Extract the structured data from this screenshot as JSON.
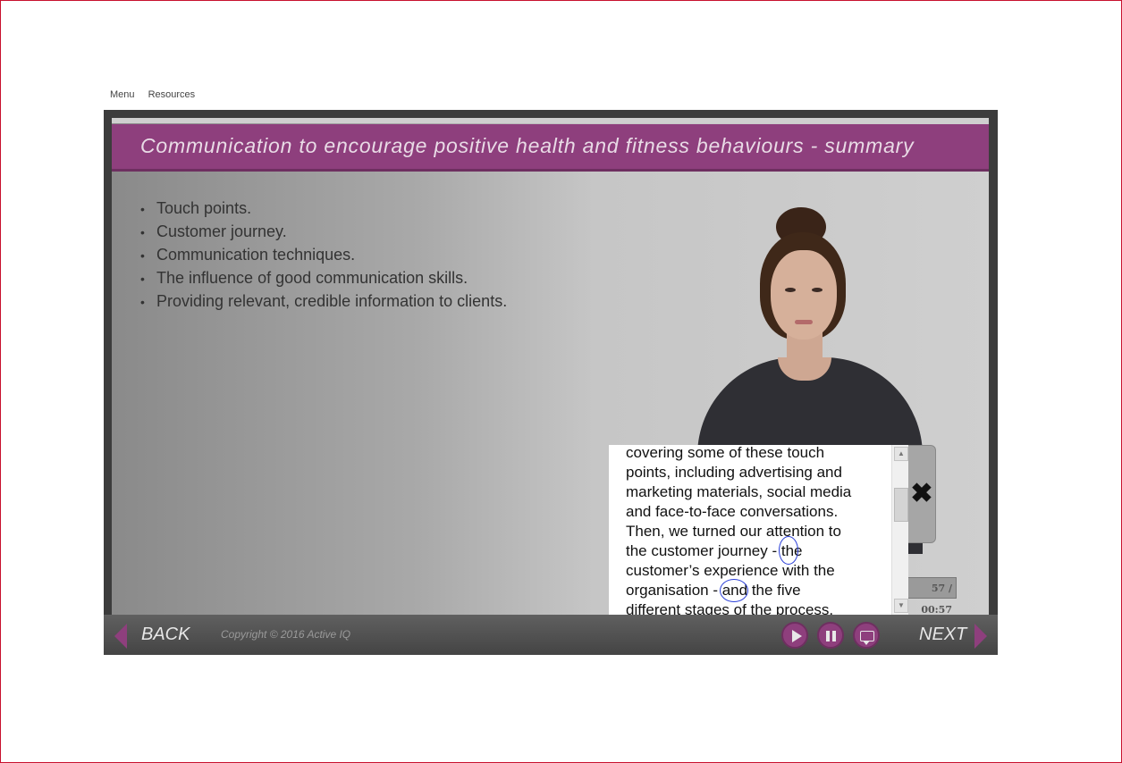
{
  "topnav": {
    "menu": "Menu",
    "resources": "Resources"
  },
  "slide": {
    "title": "Communication to encourage positive health and fitness behaviours - summary",
    "bullets": [
      "Touch points.",
      "Customer journey.",
      "Communication techniques.",
      "The influence of good communication skills.",
      "Providing relevant, credible information to clients."
    ]
  },
  "transcript": {
    "lines": [
      "covering some of these touch",
      "points, including advertising and",
      "marketing materials, social media",
      "and face-to-face conversations.",
      "Then, we turned our attention to",
      "the customer journey - the",
      "customer’s experience with the",
      "organisation - and the five",
      "different stages of the process."
    ],
    "close_symbol": "✖"
  },
  "player": {
    "time_display": "57 / 00:57",
    "back_label": "BACK",
    "next_label": "NEXT",
    "copyright": "Copyright © 2016 Active IQ"
  },
  "colors": {
    "accent": "#8e3f7d",
    "title_text": "#e9dbe6",
    "control_bar": "#4a4a4a"
  }
}
